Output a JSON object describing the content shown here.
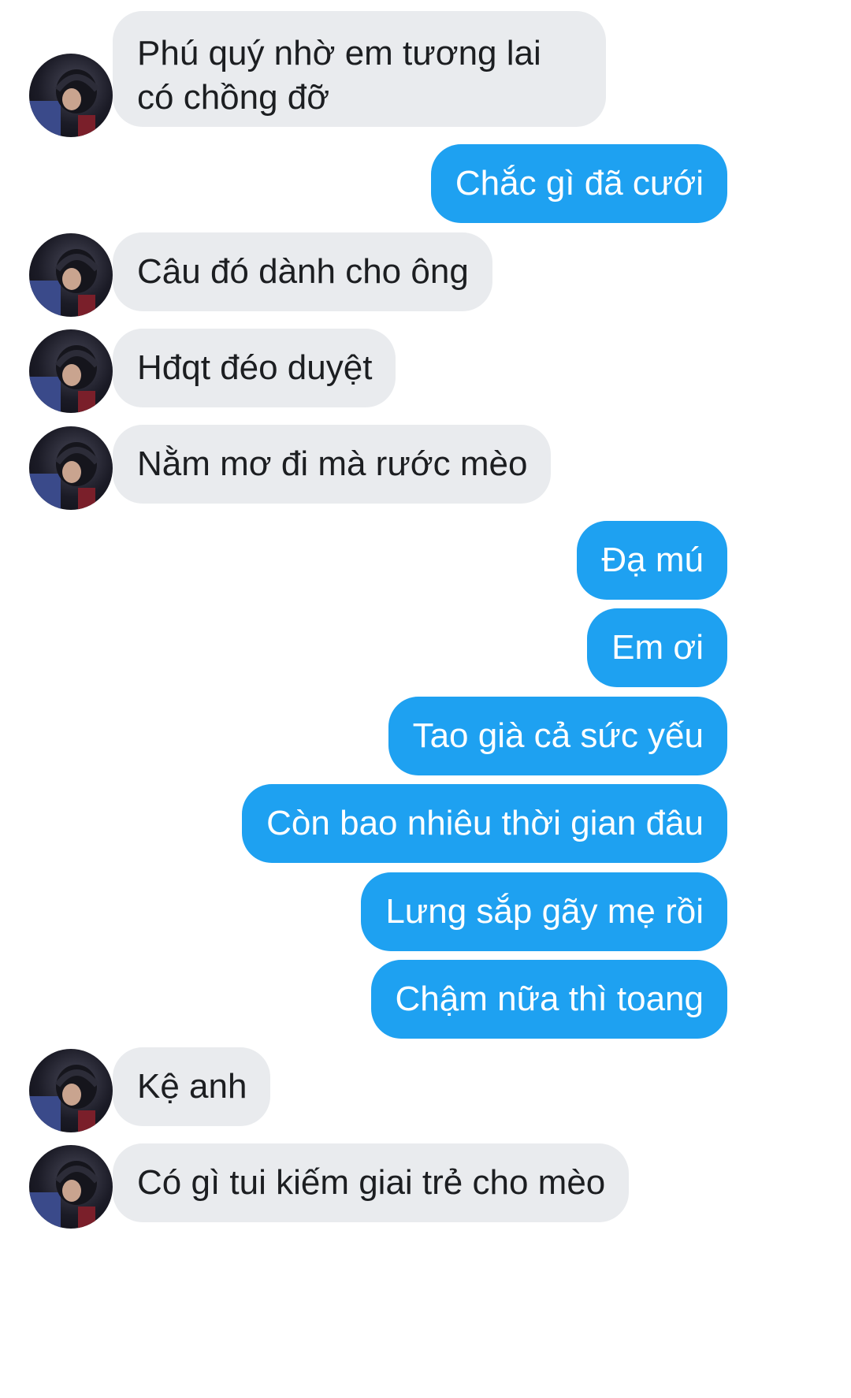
{
  "messages": [
    {
      "side": "in",
      "text": "Phú quý nhờ em tương lai có chồng đỡ"
    },
    {
      "side": "out",
      "text": "Chắc gì đã cưới"
    },
    {
      "side": "in",
      "text": "Câu đó dành cho ông"
    },
    {
      "side": "in",
      "text": "Hđqt đéo duyệt"
    },
    {
      "side": "in",
      "text": "Nằm mơ đi mà rước mèo"
    },
    {
      "side": "out",
      "text": "Đạ mú"
    },
    {
      "side": "out",
      "text": "Em ơi"
    },
    {
      "side": "out",
      "text": "Tao già cả sức yếu"
    },
    {
      "side": "out",
      "text": "Còn bao nhiêu thời gian đâu"
    },
    {
      "side": "out",
      "text": "Lưng sắp gãy mẹ rồi"
    },
    {
      "side": "out",
      "text": "Chậm nữa thì toang"
    },
    {
      "side": "in",
      "text": "Kệ anh"
    },
    {
      "side": "in",
      "text": "Có gì tui kiếm giai trẻ cho mèo"
    }
  ],
  "colors": {
    "incoming_bubble": "#e9ebee",
    "outgoing_bubble": "#1ea1f1"
  },
  "icons": {
    "avatar": "user-avatar-photo"
  }
}
